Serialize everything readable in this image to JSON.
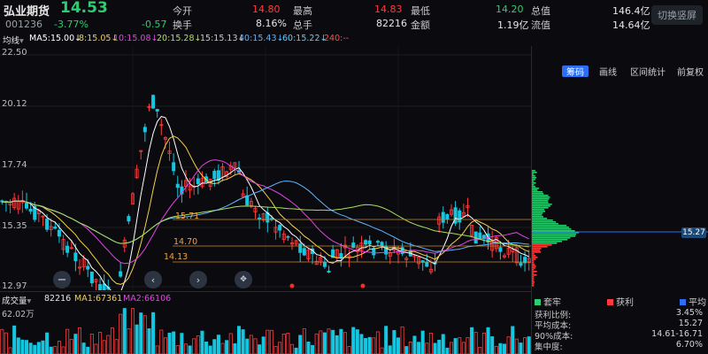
{
  "header": {
    "stock_name": "弘业期货",
    "price": "14.53",
    "code": "001236",
    "change_pct": "-3.77%",
    "change_amt": "-0.57",
    "open_label": "今开",
    "open_val": "14.80",
    "high_label": "最高",
    "high_val": "14.83",
    "low_label": "最低",
    "low_val": "14.20",
    "mktcap_label": "总值",
    "mktcap_val": "146.4亿",
    "turnover_label": "换手",
    "turnover_val": "8.16%",
    "volume_label": "总手",
    "volume_val": "82216",
    "amount_label": "金额",
    "amount_val": "1.19亿",
    "float_label": "流值",
    "float_val": "14.64亿",
    "switch_btn": "切换竖屏"
  },
  "ma_bar": {
    "avg_label": "均线",
    "ma5": "MA5:15.00↓",
    "ma8": "8:15.05↓",
    "ma10": "10:15.08↓",
    "ma20": "20:15.28↓",
    "ma15": "15:15.13↓",
    "ma40": "40:15.43↓",
    "ma60": "60:15.22↓",
    "ma240": "240:--",
    "tabs": [
      "筹码",
      "画线",
      "区间统计",
      "前复权"
    ]
  },
  "axis": {
    "y_labels": [
      "22.50",
      "20.12",
      "17.74",
      "15.35",
      "12.97"
    ],
    "price_lines": [
      "15.71",
      "14.70",
      "14.13"
    ]
  },
  "volume": {
    "label": "成交量",
    "vol": "82216",
    "ma1": "MA1:67361",
    "ma2": "MA2:66106",
    "y_top": "62.02万"
  },
  "chips": {
    "legend": [
      "套牢",
      "获利",
      "平均"
    ],
    "avg_price_tag": "15.27",
    "rows": [
      {
        "k": "获利比例:",
        "v": "3.45%"
      },
      {
        "k": "平均成本:",
        "v": "15.27"
      },
      {
        "k": "90%成本:",
        "v": "14.61-16.71"
      },
      {
        "k": "集中度:",
        "v": "6.70%"
      }
    ]
  },
  "colors": {
    "up": "#ff3b3b",
    "down": "#14c6e0",
    "green": "#2ecc71",
    "ma5": "#ffffff",
    "ma10": "#f5d04a",
    "ma20": "#e543e5",
    "ma40": "#5db5ff",
    "ma60": "#a7e05a"
  }
}
